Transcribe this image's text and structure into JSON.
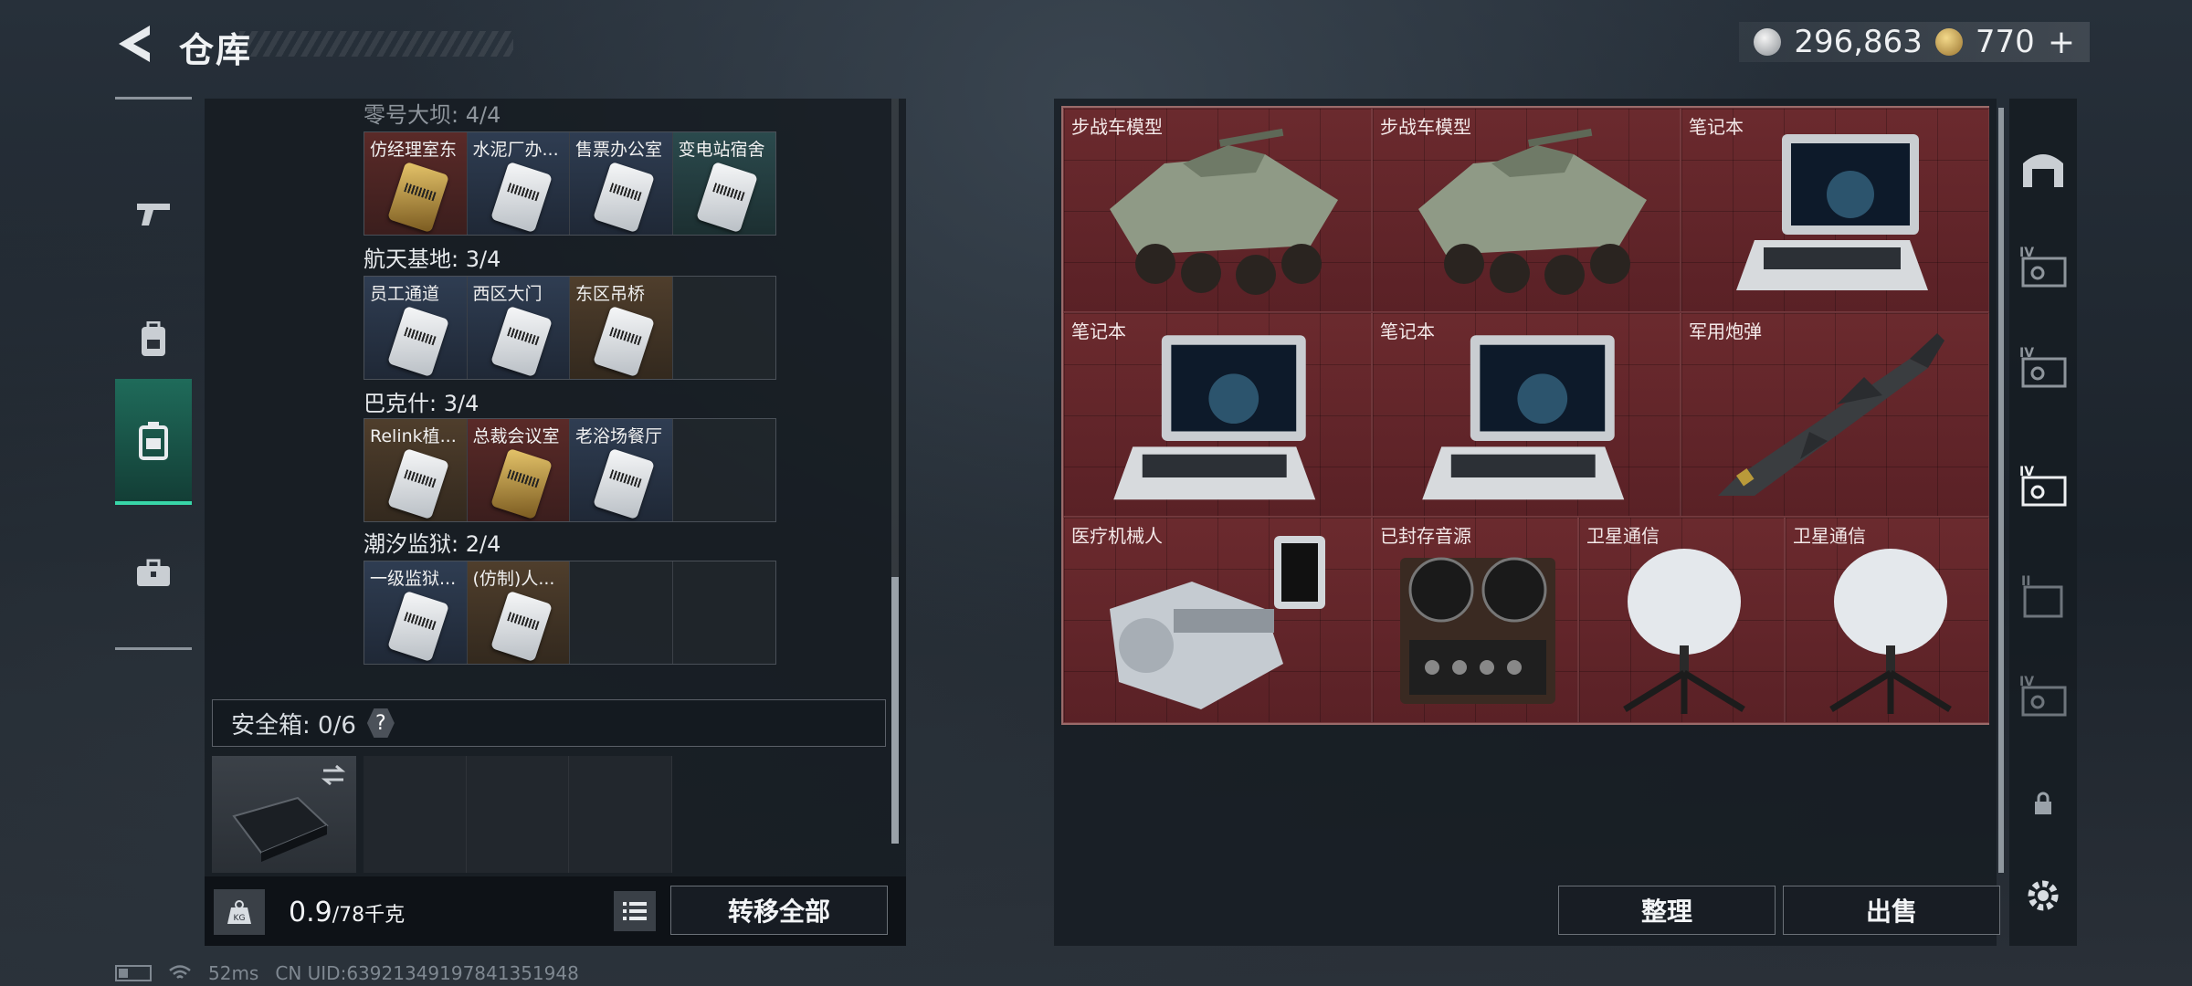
{
  "header": {
    "title": "仓库",
    "silver_amount": "296,863",
    "gold_amount": "770",
    "plus_label": "+"
  },
  "left_rail": {
    "items": [
      "gun-icon",
      "backpack-icon",
      "case-icon",
      "briefcase-icon"
    ],
    "active_index": 2
  },
  "key_groups": [
    {
      "title": "零号大坝: 4/4",
      "cells": [
        {
          "label": "仿经理室东",
          "color": "red",
          "card": "gold"
        },
        {
          "label": "水泥厂办...",
          "color": "blue",
          "card": "silver"
        },
        {
          "label": "售票办公室",
          "color": "blue",
          "card": "silver"
        },
        {
          "label": "变电站宿舍",
          "color": "teal",
          "card": "silver"
        }
      ]
    },
    {
      "title": "航天基地: 3/4",
      "cells": [
        {
          "label": "员工通道",
          "color": "blue",
          "card": "silver"
        },
        {
          "label": "西区大门",
          "color": "blue",
          "card": "silver"
        },
        {
          "label": "东区吊桥",
          "color": "brown",
          "card": "silver"
        },
        {
          "label": "",
          "color": "empty",
          "card": ""
        }
      ]
    },
    {
      "title": "巴克什: 3/4",
      "cells": [
        {
          "label": "Relink植...",
          "color": "brown",
          "card": "silver"
        },
        {
          "label": "总裁会议室",
          "color": "red",
          "card": "gold"
        },
        {
          "label": "老浴场餐厅",
          "color": "blue",
          "card": "silver"
        },
        {
          "label": "",
          "color": "empty",
          "card": ""
        }
      ]
    },
    {
      "title": "潮汐监狱: 2/4",
      "cells": [
        {
          "label": "一级监狱...",
          "color": "blue",
          "card": "silver"
        },
        {
          "label": "(仿制)人...",
          "color": "brown",
          "card": "silver"
        },
        {
          "label": "",
          "color": "empty",
          "card": ""
        },
        {
          "label": "",
          "color": "empty",
          "card": ""
        }
      ]
    }
  ],
  "safe_box": {
    "label": "安全箱: 0/6",
    "help": "?"
  },
  "weight": {
    "kg_icon": "KG",
    "current": "0.9",
    "max": "/78千克"
  },
  "buttons": {
    "transfer_all": "转移全部",
    "organize": "整理",
    "sell": "出售"
  },
  "inventory": [
    {
      "label": "步战车模型",
      "art": "vehicle"
    },
    {
      "label": "步战车模型",
      "art": "vehicle"
    },
    {
      "label": "笔记本",
      "art": "laptop"
    },
    {
      "label": "笔记本",
      "art": "laptop"
    },
    {
      "label": "笔记本",
      "art": "laptop"
    },
    {
      "label": "军用炮弹",
      "art": "missile"
    },
    {
      "label": "医疗机械人",
      "art": "robot"
    },
    {
      "label": "已封存音源",
      "art": "recorder"
    },
    {
      "label": "卫星通信",
      "art": "dish"
    },
    {
      "label": "卫星通信",
      "art": "dish"
    }
  ],
  "right_rail": {
    "items": [
      "warehouse-icon",
      "iv-case-icon",
      "iv-case-icon",
      "iv-case-active-icon",
      "ii-case-icon",
      "iv-case-icon",
      "lock-icon",
      "gear-icon"
    ],
    "tier_labels": [
      "IV",
      "IV",
      "IV",
      "II",
      "IV"
    ]
  },
  "status_bar": {
    "ping": "52ms",
    "uid": "CN UID:63921349197841351948"
  },
  "colors": {
    "accent": "#38d6a8",
    "inventory_bg": "#5a2126"
  }
}
